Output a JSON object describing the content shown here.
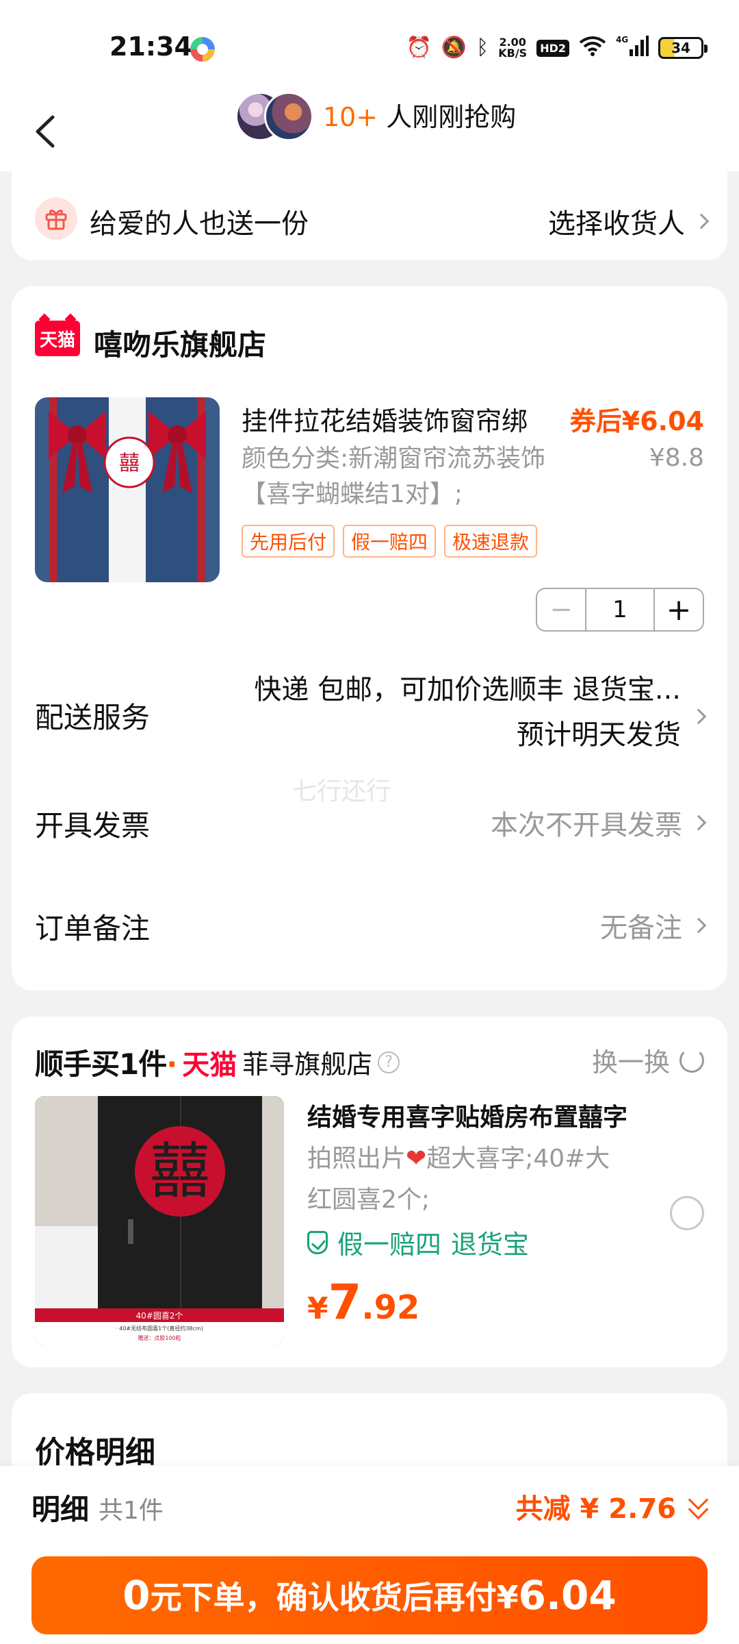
{
  "status_bar": {
    "time": "21:34",
    "speed_top": "2.00",
    "speed_bottom": "KB/S",
    "hd": "HD2",
    "network": "4G",
    "battery": "34"
  },
  "header": {
    "rush_count": "10+",
    "rush_text": " 人刚刚抢购"
  },
  "gift": {
    "title": "给爱的人也送一份",
    "action": "选择收货人"
  },
  "order": {
    "store_badge": "天猫",
    "store_name": "嘻吻乐旗舰店",
    "product_title": "挂件拉花结婚装饰窗帘绑",
    "price_after_coupon": "券后¥6.04",
    "spec": "颜色分类:新潮窗帘流苏装饰【喜字蝴蝶结1对】;",
    "original_price": "¥8.8",
    "tags": [
      "先用后付",
      "假一赔四",
      "极速退款"
    ],
    "quantity": "1",
    "shipping_label": "配送服务",
    "shipping_line1": "快递 包邮，可加价选顺丰 退货宝...",
    "shipping_line2": "预计明天发货",
    "watermark": "七行还行",
    "invoice_label": "开具发票",
    "invoice_value": "本次不开具发票",
    "remark_label": "订单备注",
    "remark_value": "无备注"
  },
  "addon": {
    "brand": "顺手买1件",
    "brand_dot": "·",
    "tmall": "天猫",
    "store": "菲寻旗舰店",
    "help": "?",
    "swap": "换一换",
    "title": "结婚专用喜字贴婚房布置囍字",
    "spec_pre": "拍照出片",
    "spec_heart": "❤",
    "spec_post": "超大喜字;40#大红圆喜2个;",
    "badge1": "假一赔四",
    "badge2": "退货宝",
    "price_currency": "¥",
    "price_int": "7",
    "price_dec": ".92",
    "img_caption": "40#圆喜2个",
    "img_sub1": "· 40#无纺布圆喜1个(直径约38cm)",
    "img_sub2": "赠送：点胶100粒"
  },
  "price_detail": {
    "title": "价格明细"
  },
  "bottom": {
    "detail_label": "明细",
    "detail_count": "共1件",
    "reduce_text": "共减 ¥ 2.76",
    "cta_big": "0",
    "cta_text": "元下单，确认收货后再付¥",
    "cta_amount": "6.04"
  },
  "colors": {
    "accent": "#ff5000",
    "tmall_red": "#ff0036",
    "green": "#18a37a"
  }
}
